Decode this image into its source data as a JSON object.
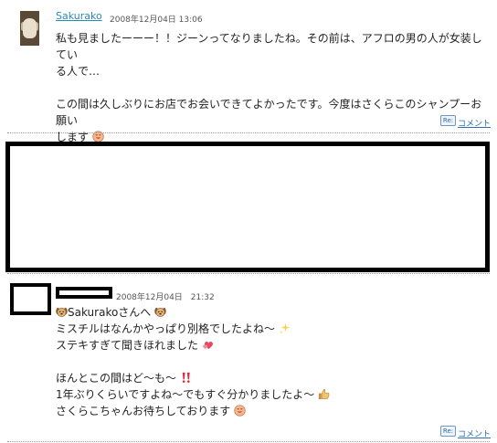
{
  "comment1": {
    "author": "Sakurako",
    "datetime": "2008年12月04日 13:06",
    "line1": "私も見ましたーーー！！ジーンってなりましたね。その前は、アフロの男の人が女装してい",
    "line2": "る人で…",
    "line3": "この間は久しぶりにお店でお会いできてよかったです。今度はさくらこのシャンプーお願い",
    "line4": "します",
    "reply_label": "コメント",
    "re_icon": "Re:"
  },
  "comment2": {
    "datetime": "2008年12月04日　21:32",
    "line1": "Sakurakoさんへ",
    "line2": "ミスチルはなんかやっぱり別格でしたよね～",
    "line3": "ステキすぎて聞きほれました",
    "line4": "ほんとこの間はど～も～",
    "line5": "1年ぶりくらいですよね～でもすぐ分かりましたよ～",
    "line6": "さくらこちゃんお待ちしております",
    "reply_label": "コメント",
    "re_icon": "Re:"
  },
  "icons": [
    "smile-emoji-icon",
    "dog-emoji-icon",
    "sparkle-icon",
    "heart-icon",
    "exclamation-icon",
    "thumbs-up-icon",
    "re-icon"
  ]
}
